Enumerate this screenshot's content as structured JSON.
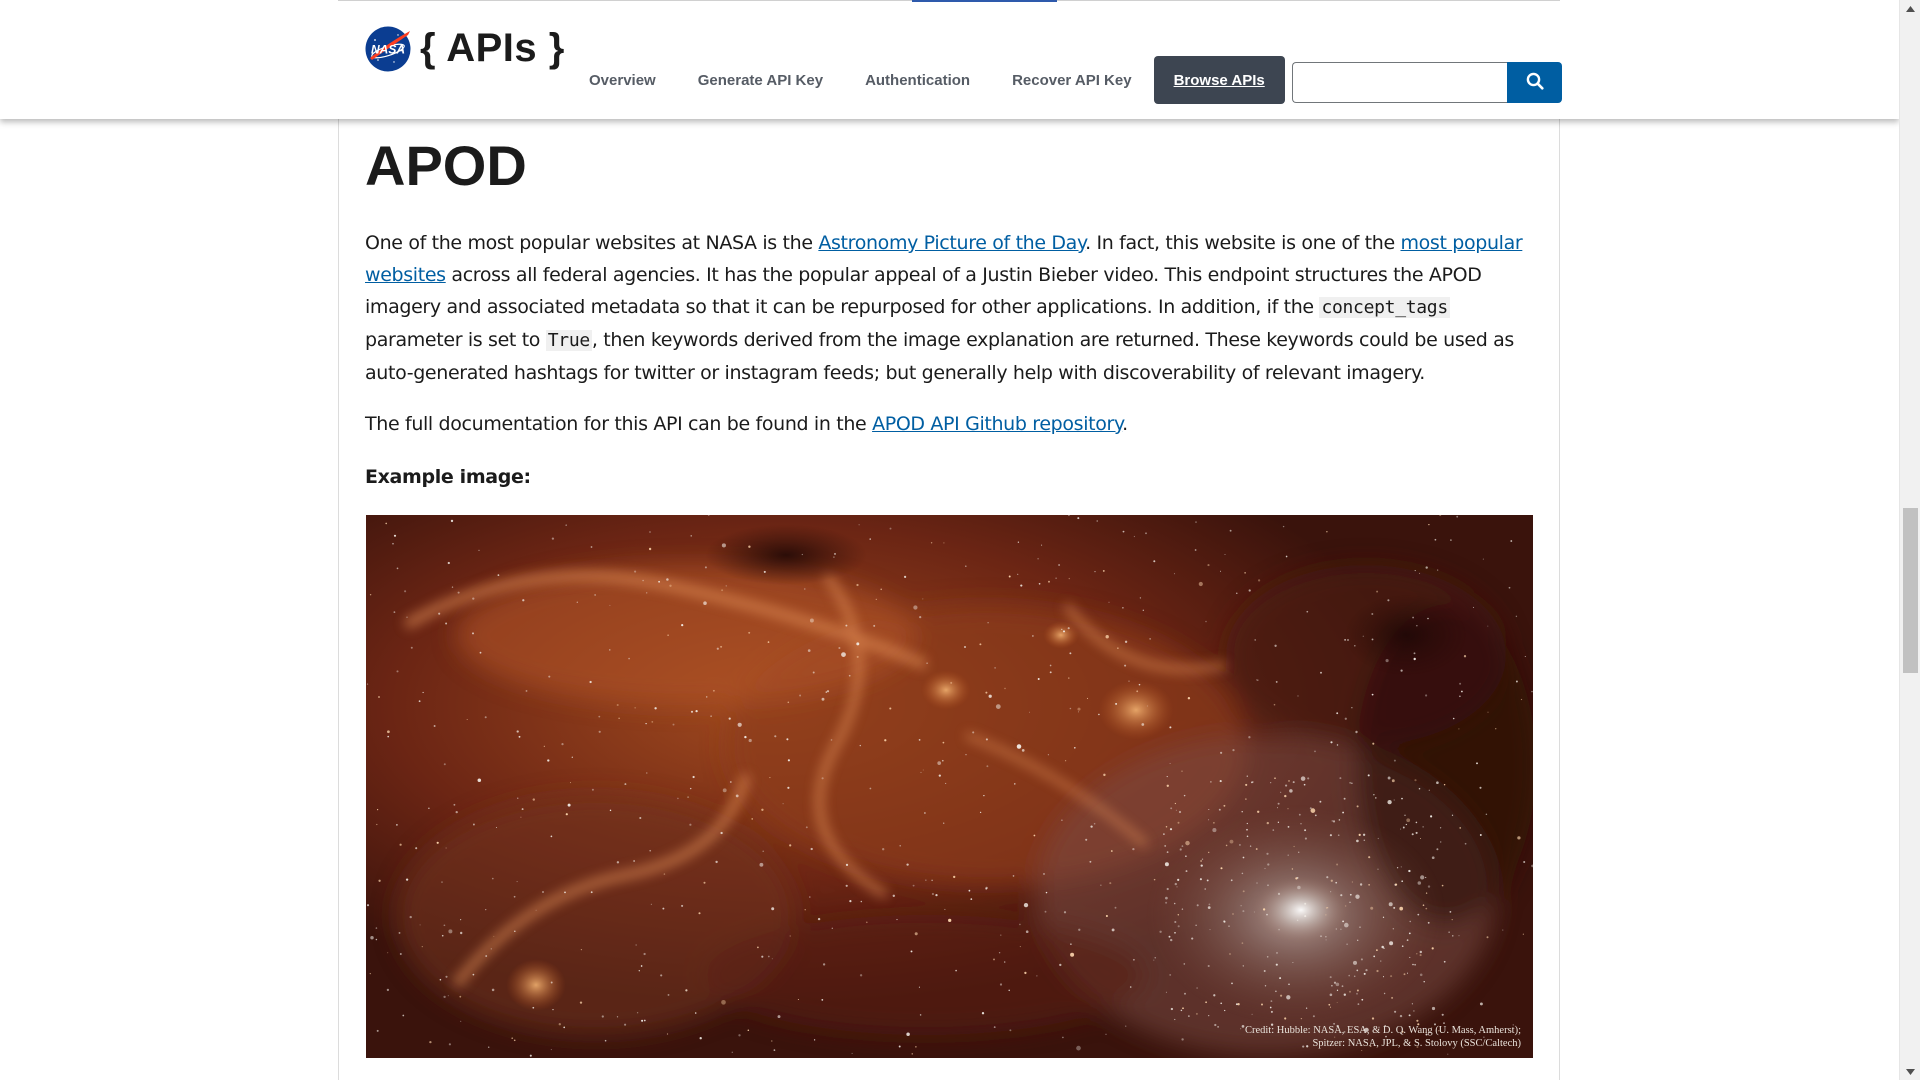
{
  "header": {
    "logo_alt": "NASA",
    "logo_text": "{ APIs }",
    "nav": [
      {
        "label": "Overview"
      },
      {
        "label": "Generate API Key"
      },
      {
        "label": "Authentication"
      },
      {
        "label": "Recover API Key"
      },
      {
        "label": "Browse APIs",
        "active": true
      }
    ],
    "search": {
      "value": "",
      "placeholder": ""
    }
  },
  "article": {
    "title": "APOD",
    "p1": {
      "t1": "One of the most popular websites at NASA is the ",
      "link1": "Astronomy Picture of the Day",
      "t2": ". In fact, this website is one of the ",
      "link2": "most popular websites",
      "t3": " across all federal agencies. It has the popular appeal of a Justin Bieber video. This endpoint structures the APOD imagery and associated metadata so that it can be repurposed for other applications. In addition, if the ",
      "code1": "concept_tags",
      "t4": " parameter is set to ",
      "code2": "True",
      "t5": ", then keywords derived from the image explanation are returned. These keywords could be used as auto-generated hashtags for twitter or instagram feeds; but generally help with discoverability of relevant imagery."
    },
    "p2": {
      "t1": "The full documentation for this API can be found in the ",
      "link": "APOD API Github repository",
      "t2": "."
    },
    "example_label": "Example image:",
    "image_credit_line1": "Credit: Hubble: NASA, ESA, & D. Q. Wang (U. Mass, Amherst);",
    "image_credit_line2": "Spitzer: NASA, JPL, & S. Stolovy (SSC/Caltech)"
  },
  "colors": {
    "link": "#005ea2",
    "nav_active_bg": "#3d4551",
    "search_button": "#005ea2",
    "text": "#1b1b1b"
  },
  "icons": {
    "search": "search-icon",
    "logo": "nasa-meatball-logo"
  }
}
